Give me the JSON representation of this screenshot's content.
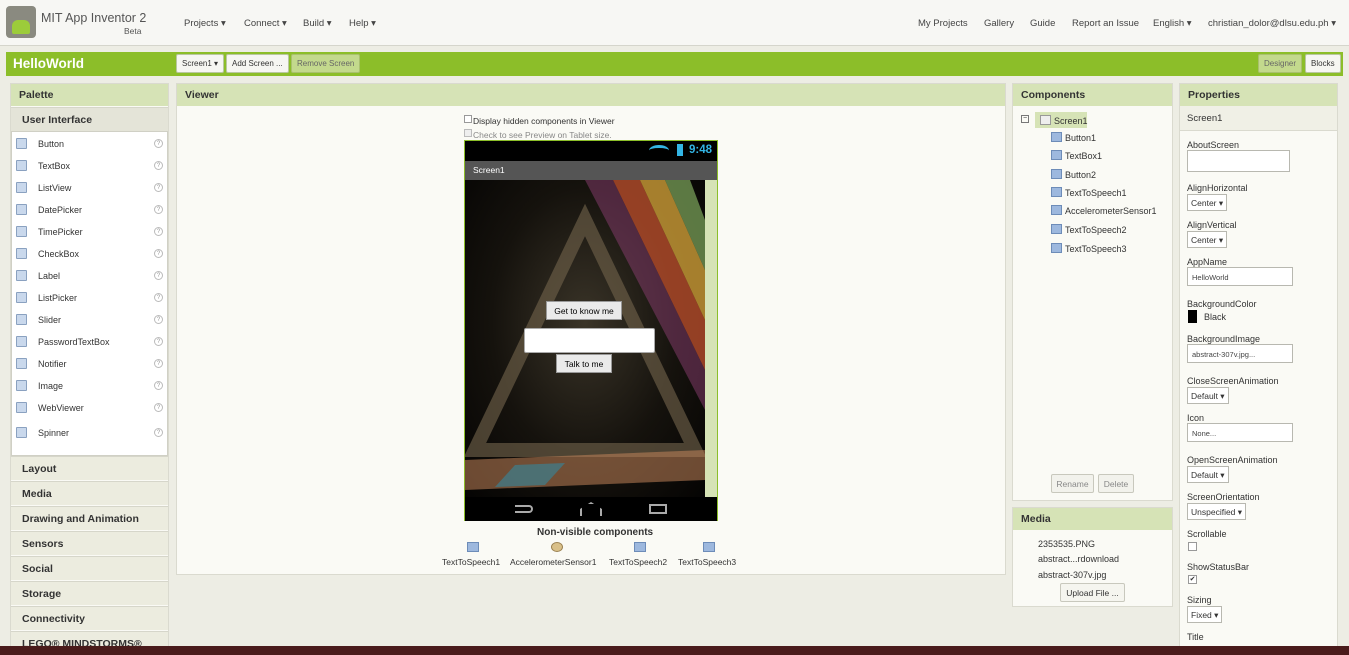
{
  "app": {
    "title": "MIT App Inventor 2",
    "subtitle": "Beta"
  },
  "topnav": {
    "projects": "Projects ▾",
    "connect": "Connect ▾",
    "build": "Build ▾",
    "help": "Help ▾",
    "my_projects": "My Projects",
    "gallery": "Gallery",
    "guide": "Guide",
    "report": "Report an Issue",
    "language": "English ▾",
    "user": "christian_dolor@dlsu.edu.ph ▾"
  },
  "project": {
    "name": "HelloWorld",
    "screen_select": "Screen1 ▾",
    "add_screen": "Add Screen ...",
    "remove_screen": "Remove Screen",
    "designer": "Designer",
    "blocks": "Blocks"
  },
  "palette": {
    "title": "Palette",
    "section": "User Interface",
    "items": [
      "Button",
      "TextBox",
      "ListView",
      "DatePicker",
      "TimePicker",
      "CheckBox",
      "Label",
      "ListPicker",
      "Slider",
      "PasswordTextBox",
      "Notifier",
      "Image",
      "WebViewer",
      "Spinner"
    ],
    "categories": [
      "Layout",
      "Media",
      "Drawing and Animation",
      "Sensors",
      "Social",
      "Storage",
      "Connectivity",
      "LEGO® MINDSTORMS®"
    ]
  },
  "viewer": {
    "title": "Viewer",
    "hidden_label": "Display hidden components in Viewer",
    "tablet_label": "Check to see Preview on Tablet size.",
    "phone_time": "9:48",
    "screen_title": "Screen1",
    "btn1": "Get to know me",
    "btn2": "Talk to me",
    "nonvisible_title": "Non-visible components",
    "nonvisible": [
      "TextToSpeech1",
      "AccelerometerSensor1",
      "TextToSpeech2",
      "TextToSpeech3"
    ]
  },
  "components": {
    "title": "Components",
    "root": "Screen1",
    "children": [
      "Button1",
      "TextBox1",
      "Button2",
      "TextToSpeech1",
      "AccelerometerSensor1",
      "TextToSpeech2",
      "TextToSpeech3"
    ],
    "rename": "Rename",
    "delete": "Delete"
  },
  "media": {
    "title": "Media",
    "files": [
      "2353535.PNG",
      "abstract...rdownload",
      "abstract-307v.jpg"
    ],
    "upload": "Upload File ..."
  },
  "properties": {
    "title": "Properties",
    "target": "Screen1",
    "about_label": "AboutScreen",
    "align_h_label": "AlignHorizontal",
    "align_h": "Center ▾",
    "align_v_label": "AlignVertical",
    "align_v": "Center ▾",
    "appname_label": "AppName",
    "appname": "HelloWorld",
    "bgcolor_label": "BackgroundColor",
    "bgcolor": "Black",
    "bgimage_label": "BackgroundImage",
    "bgimage": "abstract-307v.jpg...",
    "close_anim_label": "CloseScreenAnimation",
    "close_anim": "Default ▾",
    "icon_label": "Icon",
    "icon": "None...",
    "open_anim_label": "OpenScreenAnimation",
    "open_anim": "Default ▾",
    "orientation_label": "ScreenOrientation",
    "orientation": "Unspecified ▾",
    "scrollable_label": "Scrollable",
    "statusbar_label": "ShowStatusBar",
    "sizing_label": "Sizing",
    "sizing": "Fixed ▾",
    "title_label": "Title"
  },
  "colors": {
    "accent": "#8cbe29",
    "header": "#d6e3b6"
  }
}
